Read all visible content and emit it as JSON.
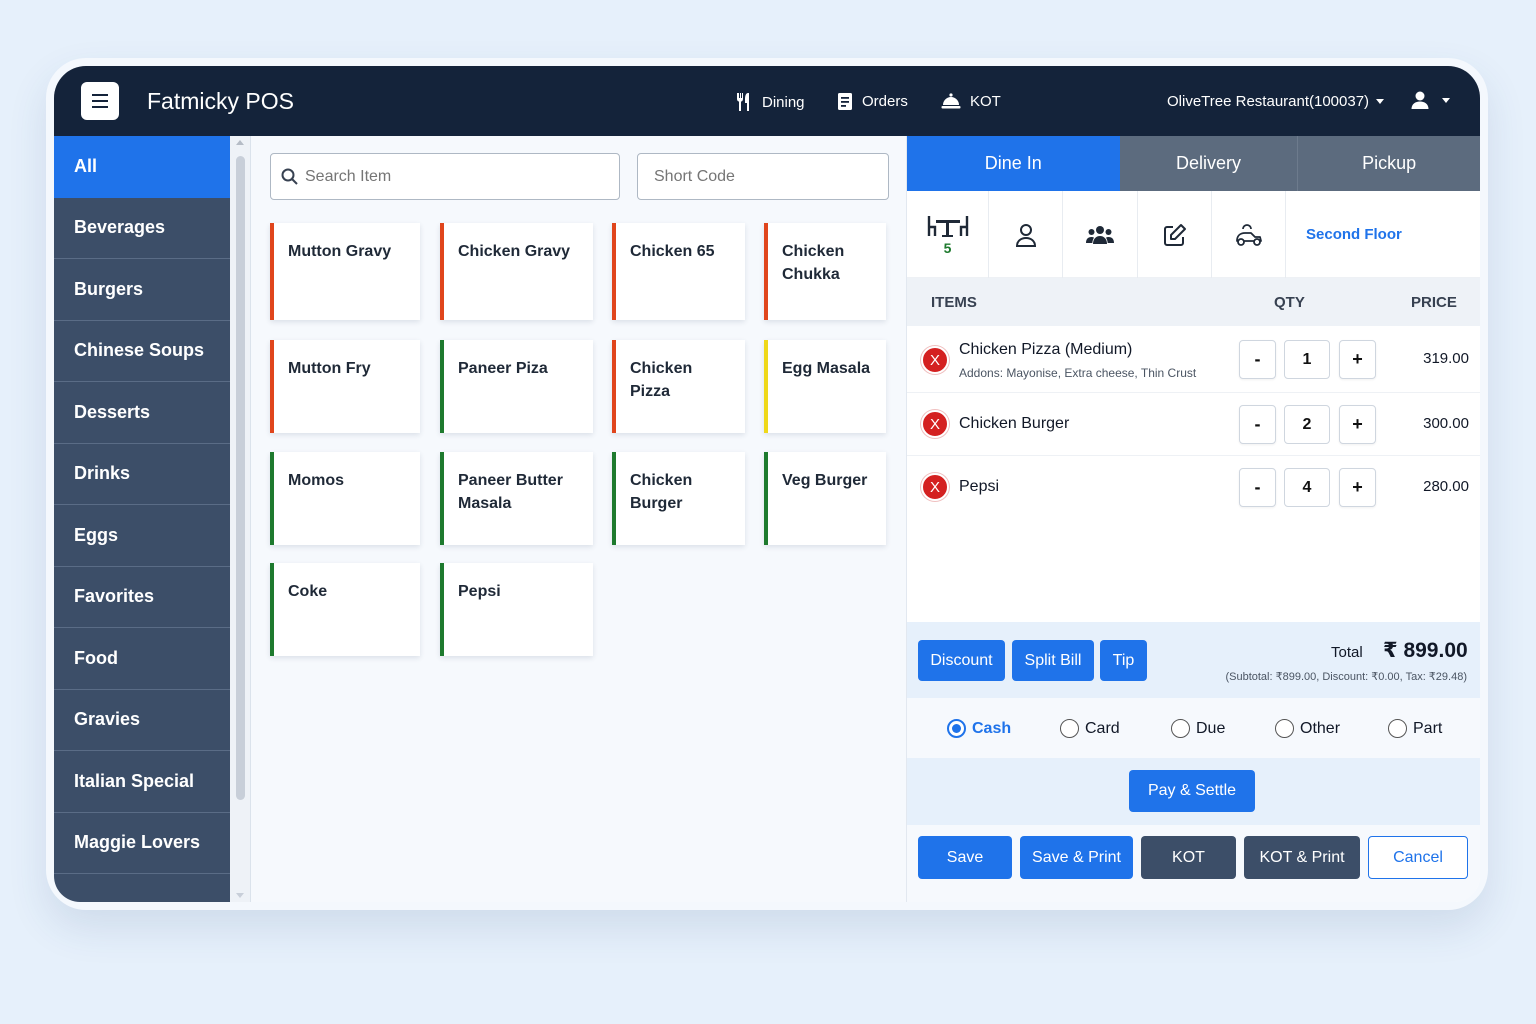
{
  "header": {
    "brand": "Fatmicky POS",
    "nav": [
      "Dining",
      "Orders",
      "KOT"
    ],
    "restaurant": "OliveTree Restaurant(100037)"
  },
  "categories": [
    "All",
    "Beverages",
    "Burgers",
    "Chinese Soups",
    "Desserts",
    "Drinks",
    "Eggs",
    "Favorites",
    "Food",
    "Gravies",
    "Italian Special",
    "Maggie Lovers"
  ],
  "search": {
    "placeholder": "Search Item",
    "code_placeholder": "Short Code"
  },
  "items": [
    {
      "name": "Mutton Gravy",
      "color": "#e0451c"
    },
    {
      "name": "Chicken Gravy",
      "color": "#e0451c"
    },
    {
      "name": "Chicken 65",
      "color": "#e0451c"
    },
    {
      "name": "Chicken Chukka",
      "color": "#e0451c"
    },
    {
      "name": "Mutton Fry",
      "color": "#e0451c"
    },
    {
      "name": "Paneer Piza",
      "color": "#1e7a2e"
    },
    {
      "name": "Chicken Pizza",
      "color": "#e0451c"
    },
    {
      "name": "Egg Masala",
      "color": "#efd81a"
    },
    {
      "name": "Momos",
      "color": "#1e7a2e"
    },
    {
      "name": "Paneer Butter Masala",
      "color": "#1e7a2e"
    },
    {
      "name": "Chicken Burger",
      "color": "#1e7a2e"
    },
    {
      "name": "Veg Burger",
      "color": "#1e7a2e"
    },
    {
      "name": "Coke",
      "color": "#1e7a2e"
    },
    {
      "name": "Pepsi",
      "color": "#1e7a2e"
    }
  ],
  "order_tabs": [
    "Dine In",
    "Delivery",
    "Pickup"
  ],
  "table_info": {
    "count": "5",
    "floor": "Second Floor",
    "icons": [
      "table-icon",
      "person-icon",
      "group-icon",
      "edit-icon",
      "delivery-scooter-icon"
    ]
  },
  "cart_headers": {
    "items": "ITEMS",
    "qty": "QTY",
    "price": "PRICE"
  },
  "cart": [
    {
      "name": "Chicken Pizza (Medium)",
      "addons": "Addons: Mayonise, Extra cheese, Thin Crust",
      "qty": "1",
      "price": "319.00"
    },
    {
      "name": "Chicken Burger",
      "addons": "",
      "qty": "2",
      "price": "300.00"
    },
    {
      "name": "Pepsi",
      "addons": "",
      "qty": "4",
      "price": "280.00"
    }
  ],
  "qty_controls": {
    "minus": "-",
    "plus": "+",
    "remove": "X"
  },
  "summary": {
    "discount": "Discount",
    "split": "Split Bill",
    "tip": "Tip",
    "total_label": "Total",
    "total": "₹ 899.00",
    "subtotal": "(Subtotal: ₹899.00, Discount: ₹0.00, Tax: ₹29.48)"
  },
  "payment_methods": [
    "Cash",
    "Card",
    "Due",
    "Other",
    "Part"
  ],
  "selected_payment": "Cash",
  "settle_label": "Pay & Settle",
  "actions": [
    "Save",
    "Save & Print",
    "KOT",
    "KOT & Print",
    "Cancel"
  ],
  "colors": {
    "primary": "#1f73ea",
    "header": "#14233a",
    "sidebar": "#3c4e68",
    "nonveg": "#e0451c",
    "veg": "#1e7a2e",
    "egg": "#efd81a"
  }
}
